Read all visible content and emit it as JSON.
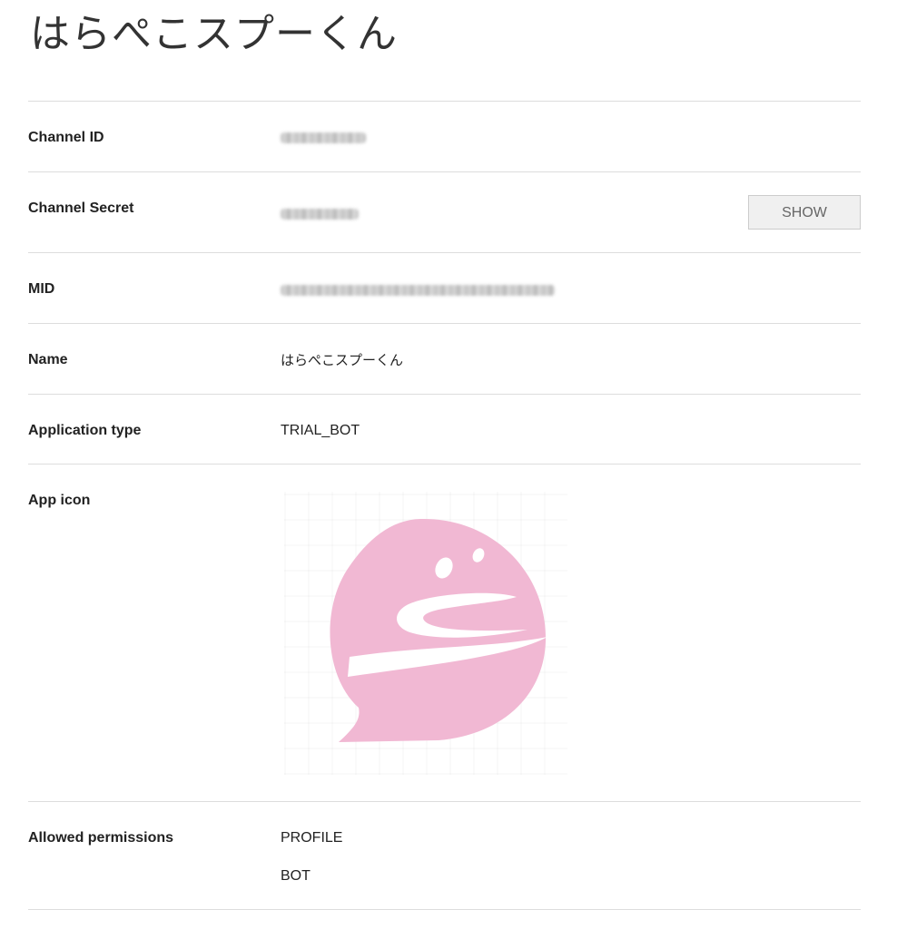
{
  "page": {
    "title": "はらぺこスプーくん"
  },
  "rows": {
    "channel_id": {
      "label": "Channel ID"
    },
    "channel_secret": {
      "label": "Channel Secret",
      "show_label": "SHOW"
    },
    "mid": {
      "label": "MID"
    },
    "name": {
      "label": "Name",
      "value": "はらぺこスプーくん"
    },
    "application_type": {
      "label": "Application type",
      "value": "TRIAL_BOT"
    },
    "app_icon": {
      "label": "App icon",
      "icon": "pink-speech-bubble-s-logo-icon",
      "color": "#f1b8d3"
    },
    "allowed_permissions": {
      "label": "Allowed permissions",
      "values": [
        "PROFILE",
        "BOT"
      ]
    }
  },
  "colors": {
    "divider": "#dddddd",
    "text": "#222222",
    "button_bg": "#f0f0f0",
    "button_text": "#666666"
  }
}
